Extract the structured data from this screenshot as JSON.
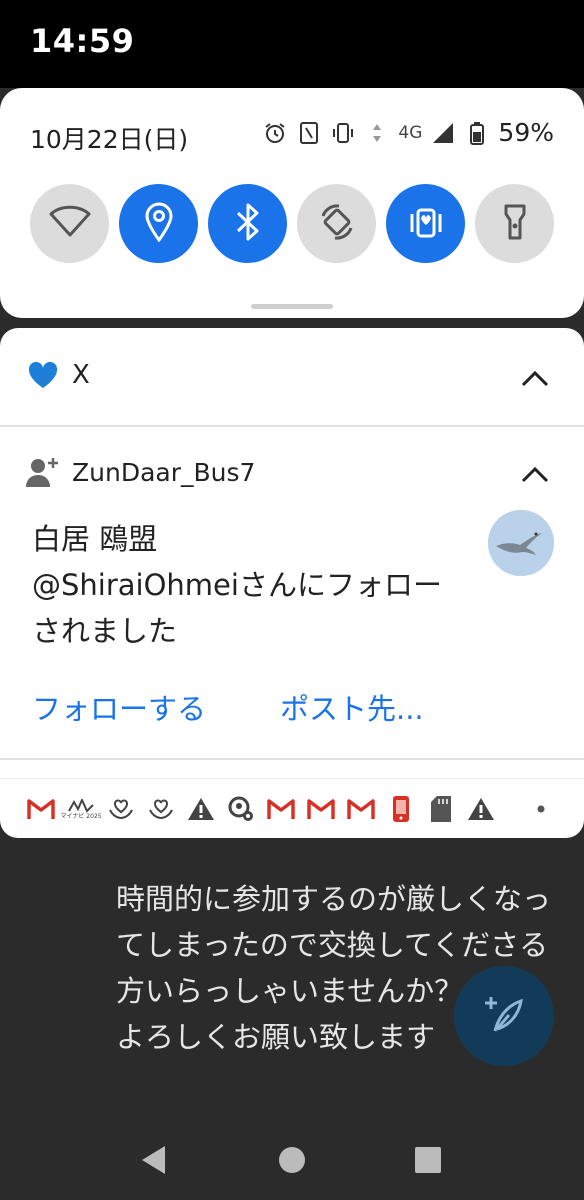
{
  "status_bar": {
    "time": "14:59"
  },
  "quick_settings": {
    "date": "10月22日(日)",
    "network": "4G",
    "battery": "59%",
    "tiles": [
      {
        "name": "wifi",
        "state": "off"
      },
      {
        "name": "location",
        "state": "on"
      },
      {
        "name": "bluetooth",
        "state": "on"
      },
      {
        "name": "auto-rotate",
        "state": "off"
      },
      {
        "name": "vibrate",
        "state": "on"
      },
      {
        "name": "flashlight",
        "state": "off"
      }
    ]
  },
  "notification": {
    "app_name": "X",
    "account": "ZunDaar_Bus7",
    "message": "白居 鴎盟\n@ShiraiOhmeiさんにフォローされました",
    "actions": {
      "follow": "フォローする",
      "post": "ポスト先..."
    },
    "small_icons": [
      "gmail-icon",
      "mynavi-icon",
      "heart-hands-icon",
      "heart-hands-icon",
      "warning-icon",
      "gear-person-icon",
      "gmail-icon",
      "gmail-icon",
      "gmail-icon",
      "phone-app-icon",
      "sd-card-icon",
      "warning-icon",
      "dot-icon"
    ],
    "mynavi_label": "マイナビ 2025"
  },
  "background_post": {
    "text": "時間的に参加するのが厳しくなってしまったので交換してくださる方いらっしゃいませんか？\nよろしくお願い致します"
  },
  "colors": {
    "accent": "#1a73e8",
    "x_heart": "#1d7fd8",
    "gmail_red": "#d93025"
  }
}
